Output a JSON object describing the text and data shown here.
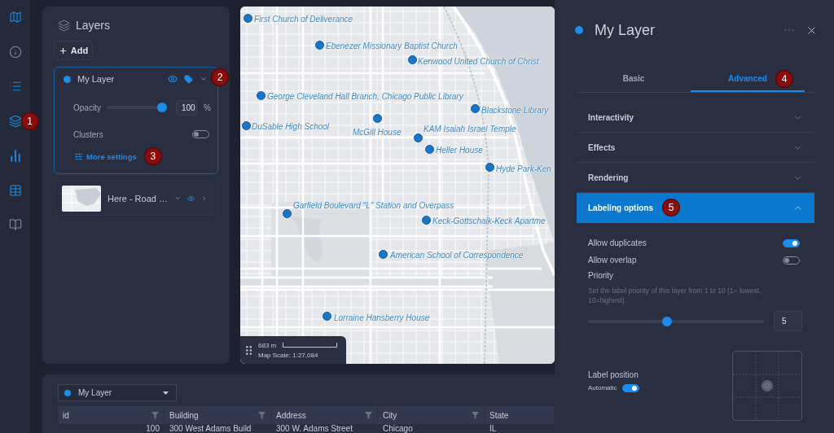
{
  "sidebar": {
    "items": [
      {
        "active": true
      },
      {
        "active": false
      },
      {
        "active": true
      },
      {
        "active": true,
        "callout": "1"
      },
      {
        "active": true
      },
      {
        "active": true
      },
      {
        "active": false
      }
    ]
  },
  "layers_panel": {
    "title": "Layers",
    "add_button": "Add",
    "layers": [
      {
        "kind": "feature",
        "name": "My Layer",
        "visible": true,
        "expanded": true,
        "callout": "2",
        "opacity": {
          "label": "Opacity",
          "level": 1,
          "value": "100",
          "unit": "%"
        },
        "clusters": {
          "label": "Clusters",
          "on": false
        },
        "more_settings": {
          "label": "More settings",
          "callout": "3"
        }
      },
      {
        "kind": "basemap",
        "name": "Here - Road …",
        "visible": true,
        "expanded": false
      }
    ]
  },
  "map": {
    "points": [
      {
        "label": "First Church of Deliverance"
      },
      {
        "label": "Ebenezer Missionary Baptist Church"
      },
      {
        "label": "Kenwood United Church of Christ"
      },
      {
        "label": "George Cleveland Hall Branch, Chicago Public Library"
      },
      {
        "label": "Blackstone Library"
      },
      {
        "label": "DuSable High School"
      },
      {
        "label": "McGill House"
      },
      {
        "label": "KAM Isaiah Israel Temple"
      },
      {
        "label": "Heller House"
      },
      {
        "label": "Hyde Park-Ken"
      },
      {
        "label": "Garfield Boulevard \"L\" Station and Overpass"
      },
      {
        "label": "Keck-Gottschalk-Keck Apartme"
      },
      {
        "label": "American School of Correspondence"
      },
      {
        "label": "Lorraine Hansberry House"
      }
    ],
    "scale": {
      "distance": "683 m",
      "ratio": "Map Scale: 1:27,084"
    }
  },
  "details_panel": {
    "title": "My Layer",
    "tabs": [
      {
        "label": "Basic",
        "selected": false
      },
      {
        "label": "Advanced",
        "selected": true,
        "callout": "4"
      }
    ],
    "sections": [
      {
        "label": "Interactivity",
        "expanded": false
      },
      {
        "label": "Effects",
        "expanded": false
      },
      {
        "label": "Rendering",
        "expanded": false
      },
      {
        "label": "Labeling options",
        "expanded": true,
        "callout": "5",
        "options": {
          "toggles": [
            {
              "label": "Allow duplicates",
              "on": true
            },
            {
              "label": "Allow overlap",
              "on": false
            }
          ],
          "priority": {
            "label": "Priority",
            "description": "Set the label priority of this layer from 1 to 10 (1= lowest, 10=highest).",
            "level": 0.444,
            "value": "5"
          },
          "label_position": {
            "label": "Label position",
            "automatic_label": "Automatic",
            "automatic": true
          }
        }
      }
    ]
  },
  "table": {
    "layer": "My Layer",
    "columns": [
      "id",
      "Building",
      "Address",
      "City",
      "State"
    ],
    "rows": [
      [
        "100",
        "300 West Adams Build",
        "300 W. Adams Street",
        "Chicago",
        "IL"
      ]
    ]
  }
}
